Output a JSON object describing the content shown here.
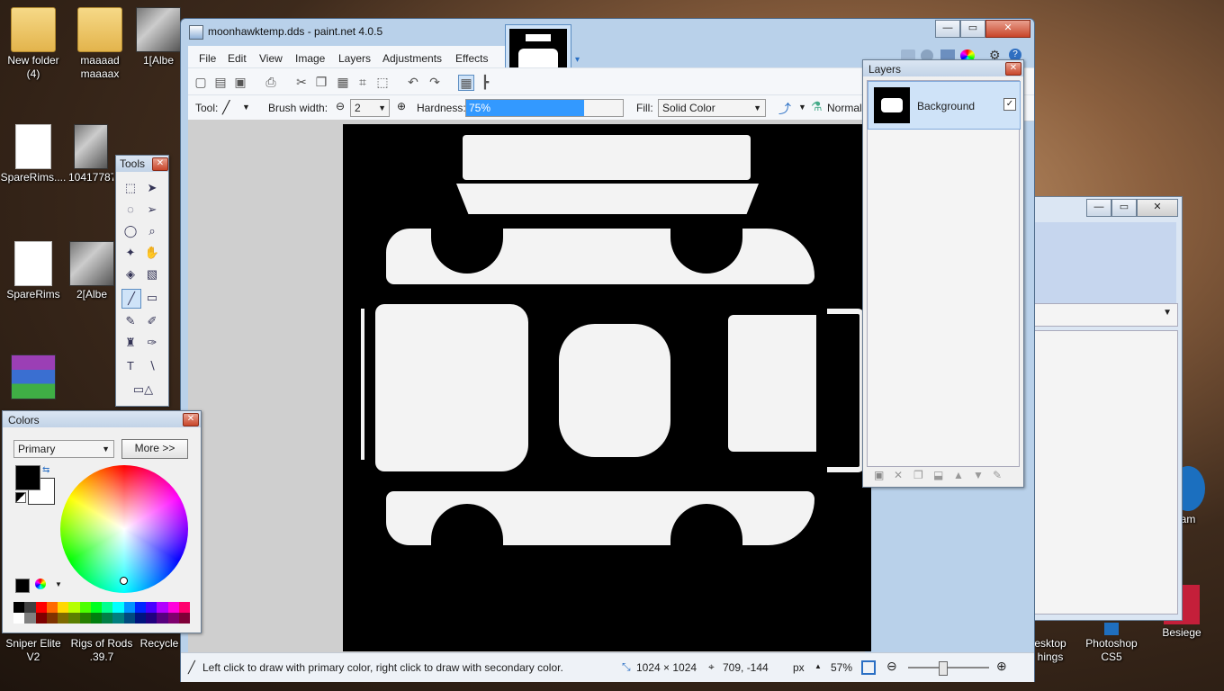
{
  "desktop": {
    "icons": [
      {
        "id": "new-folder",
        "label": "New folder (4)",
        "kind": "folder"
      },
      {
        "id": "maaaad",
        "label": "maaaad maaaax",
        "kind": "folder"
      },
      {
        "id": "albedo1",
        "label": "1[Albe",
        "kind": "thumb"
      },
      {
        "id": "sparerims-file",
        "label": "SpareRims....",
        "kind": "doc"
      },
      {
        "id": "num-file",
        "label": "10417787",
        "kind": "thumb"
      },
      {
        "id": "sparerims",
        "label": "SpareRims",
        "kind": "doc"
      },
      {
        "id": "albedo2",
        "label": "2[Albe",
        "kind": "thumb"
      },
      {
        "id": "winrar",
        "label": "",
        "kind": "thumb"
      },
      {
        "id": "sniper",
        "label": "Sniper Elite V2",
        "kind": "thumb"
      },
      {
        "id": "rigs",
        "label": "Rigs of Rods .39.7",
        "kind": "thumb"
      },
      {
        "id": "recycle",
        "label": "Recycle",
        "kind": "thumb"
      },
      {
        "id": "desktop-things",
        "label": "esktop hings",
        "kind": "thumb"
      },
      {
        "id": "photoshop",
        "label": "Photoshop CS5",
        "kind": "thumb"
      },
      {
        "id": "besiege",
        "label": "Besiege",
        "kind": "thumb"
      },
      {
        "id": "steam",
        "label": "am",
        "kind": "thumb"
      }
    ]
  },
  "window": {
    "title": "moonhawktemp.dds - paint.net 4.0.5",
    "menu": [
      "File",
      "Edit",
      "View",
      "Image",
      "Layers",
      "Adjustments",
      "Effects"
    ],
    "minimize": "—",
    "maximize": "▭",
    "close": "✕"
  },
  "toolbar": {
    "tool_label": "Tool:",
    "brush_width_label": "Brush width:",
    "brush_width_value": "2",
    "hardness_label": "Hardness:",
    "hardness_value": "75%",
    "hardness_fraction": 0.75,
    "fill_label": "Fill:",
    "fill_value": "Solid Color",
    "blend_value": "Normal"
  },
  "tools_panel": {
    "title": "Tools",
    "close": "✕"
  },
  "colors_panel": {
    "title": "Colors",
    "close": "✕",
    "mode": "Primary",
    "more": "More >>",
    "palette": [
      "#000000",
      "#404040",
      "#ff0000",
      "#ff6a00",
      "#ffd800",
      "#b6ff00",
      "#4cff00",
      "#00ff21",
      "#00ff90",
      "#00ffff",
      "#0094ff",
      "#0026ff",
      "#4800ff",
      "#b200ff",
      "#ff00dc",
      "#ff006e",
      "#ffffff",
      "#808080",
      "#7f0000",
      "#7f3300",
      "#7f6a00",
      "#5b7f00",
      "#267f00",
      "#007f0e",
      "#007f46",
      "#007f7f",
      "#004a7f",
      "#00137f",
      "#21007f",
      "#57007f",
      "#7f006e",
      "#7f0037"
    ]
  },
  "layers_panel": {
    "title": "Layers",
    "close": "✕",
    "layers": [
      {
        "name": "Background",
        "visible": true
      }
    ]
  },
  "status": {
    "hint": "Left click to draw with primary color, right click to draw with secondary color.",
    "size": "1024 × 1024",
    "cursor": "709, -144",
    "unit": "px",
    "zoom": "57%"
  },
  "colors": {
    "accent": "#3399ff",
    "canvas_bg": "#000000"
  }
}
